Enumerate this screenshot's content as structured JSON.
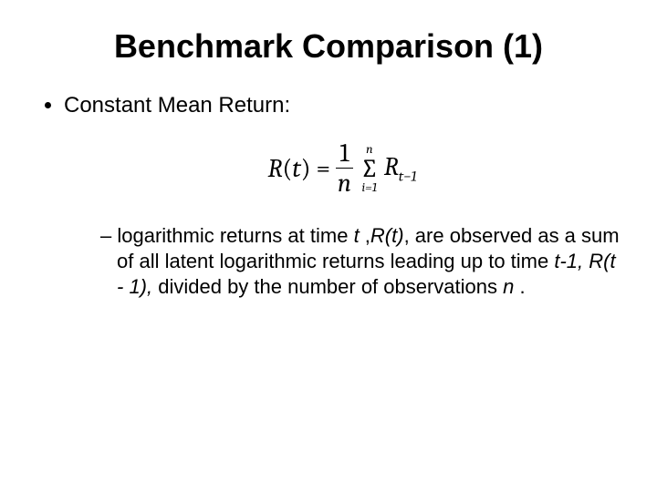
{
  "title": "Benchmark Comparison (1)",
  "bullet1": "Constant Mean Return:",
  "equation": {
    "lhs_func": "R",
    "lhs_arg": "t",
    "frac_num": "1",
    "frac_den": "n",
    "sum_lower": "i=1",
    "sum_upper": "n",
    "sum_symbol": "∑",
    "term_base": "R",
    "term_sub": "t−1"
  },
  "subbullet": {
    "pre": "logarithmic returns at time ",
    "t": "t ",
    "comma": ",",
    "rt": "R(t)",
    "mid1": ", are observed as a sum of all latent logarithmic returns leading up to time ",
    "tminus1": "t-1, ",
    "rt1": "R(t - 1),",
    "mid2": " divided by the number of observations ",
    "n": "n",
    "period": " ."
  }
}
